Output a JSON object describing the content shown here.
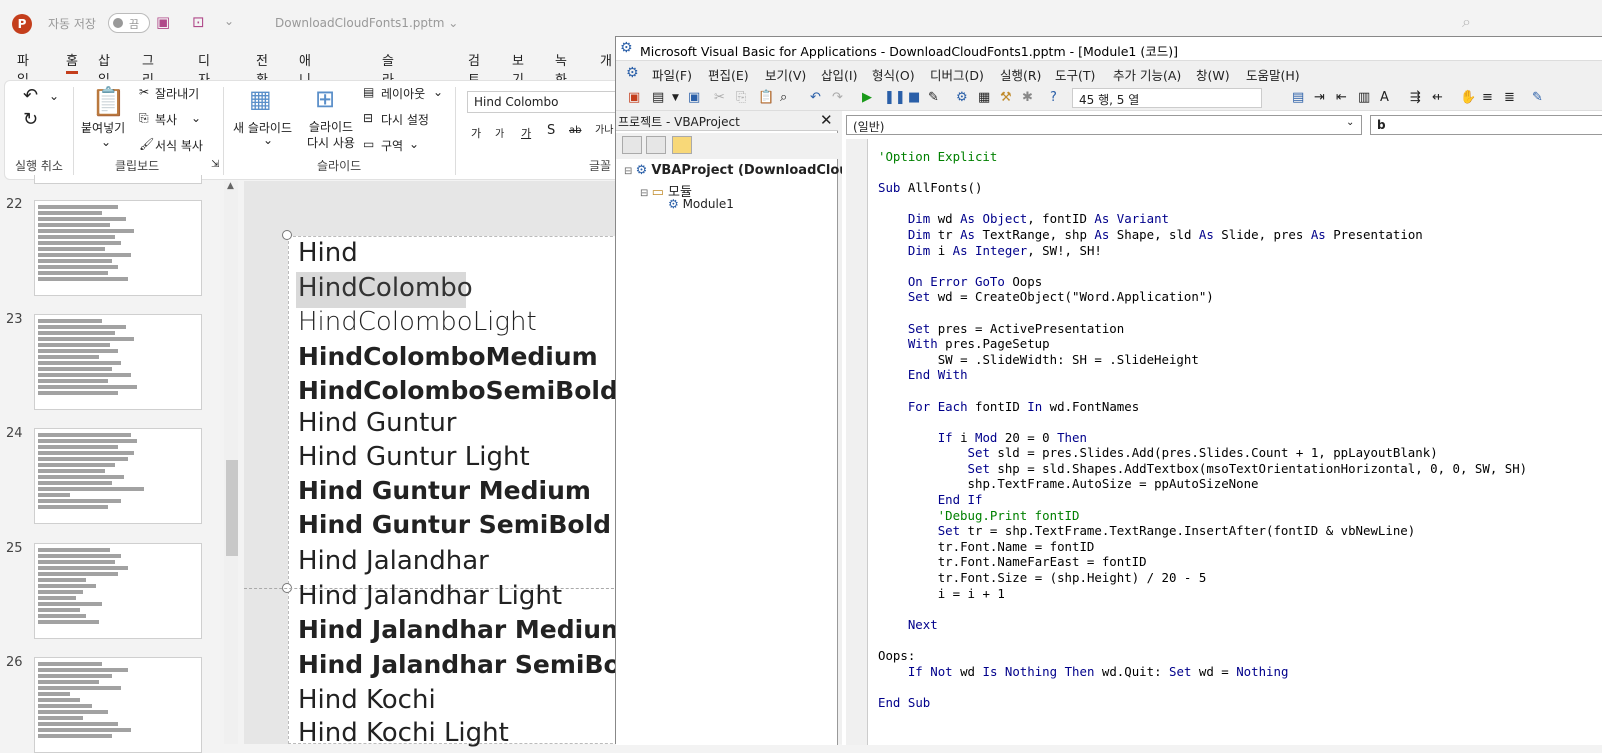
{
  "ppt": {
    "logo": "P",
    "autosave_label": "자동 저장",
    "toggle_text": "끔",
    "filename": "DownloadCloudFonts1.pptm ⌄",
    "tabs": [
      "파일",
      "홈",
      "삽입",
      "그리기",
      "디자인",
      "전환",
      "애니메이션",
      "슬라이드 쇼",
      "검토",
      "보기",
      "녹화",
      "개"
    ],
    "ribbon": {
      "undo_group": "실행 취소",
      "paste": "붙여넣기",
      "cut": "잘라내기",
      "copy": "복사",
      "format_painter": "서식 복사",
      "clipboard_group": "클립보드",
      "new_slide": "새 슬라이드",
      "reuse_slide": "슬라이드 다시 사용",
      "layout": "레이아웃",
      "reset": "다시 설정",
      "section": "구역",
      "slides_group": "슬라이드",
      "font_name": "Hind Colombo",
      "font_group": "글꼴",
      "font_buttons": [
        "가",
        "가",
        "가",
        "S",
        "ab",
        "가나"
      ]
    },
    "thumbnail_numbers": [
      "22",
      "23",
      "24",
      "25",
      "26"
    ],
    "slide_lines": [
      {
        "text": "Hind",
        "bold": false
      },
      {
        "text": "HindColombo",
        "bold": false
      },
      {
        "text": "HindColomboLight",
        "bold": false
      },
      {
        "text": "HindColomboMedium",
        "bold": true
      },
      {
        "text": "HindColomboSemiBold",
        "bold": true
      },
      {
        "text": "Hind Guntur",
        "bold": false
      },
      {
        "text": "Hind Guntur Light",
        "bold": false
      },
      {
        "text": "Hind Guntur Medium",
        "bold": true
      },
      {
        "text": "Hind Guntur SemiBold",
        "bold": true
      },
      {
        "text": "Hind Jalandhar",
        "bold": false
      },
      {
        "text": "Hind Jalandhar Light",
        "bold": false
      },
      {
        "text": "Hind Jalandhar Medium",
        "bold": true
      },
      {
        "text": "Hind Jalandhar SemiBold",
        "bold": true
      },
      {
        "text": "Hind Kochi",
        "bold": false
      },
      {
        "text": "Hind Kochi Light",
        "bold": false
      }
    ]
  },
  "vba": {
    "title": "Microsoft Visual Basic for Applications - DownloadCloudFonts1.pptm - [Module1 (코드)]",
    "menu": [
      "파일(F)",
      "편집(E)",
      "보기(V)",
      "삽입(I)",
      "형식(O)",
      "디버그(D)",
      "실행(R)",
      "도구(T)",
      "추가 기능(A)",
      "창(W)",
      "도움말(H)"
    ],
    "position": "45 행, 5 열",
    "project_title": "프로젝트 - VBAProject",
    "tree": {
      "root": "VBAProject (DownloadClou",
      "folder": "모듈",
      "module": "Module1"
    },
    "object_combo": "(일반)",
    "proc_combo": "b",
    "code_lines": [
      "'Option Explicit",
      "",
      "Sub AllFonts()",
      "",
      "    Dim wd As Object, fontID As Variant",
      "    Dim tr As TextRange, shp As Shape, sld As Slide, pres As Presentation",
      "    Dim i As Integer, SW!, SH!",
      "",
      "    On Error GoTo Oops",
      "    Set wd = CreateObject(\"Word.Application\")",
      "",
      "    Set pres = ActivePresentation",
      "    With pres.PageSetup",
      "        SW = .SlideWidth: SH = .SlideHeight",
      "    End With",
      "",
      "    For Each fontID In wd.FontNames",
      "",
      "        If i Mod 20 = 0 Then",
      "            Set sld = pres.Slides.Add(pres.Slides.Count + 1, ppLayoutBlank)",
      "            Set shp = sld.Shapes.AddTextbox(msoTextOrientationHorizontal, 0, 0, SW, SH)",
      "            shp.TextFrame.AutoSize = ppAutoSizeNone",
      "        End If",
      "        'Debug.Print fontID",
      "        Set tr = shp.TextFrame.TextRange.InsertAfter(fontID & vbNewLine)",
      "        tr.Font.Name = fontID",
      "        tr.Font.NameFarEast = fontID",
      "        tr.Font.Size = (shp.Height) / 20 - 5",
      "        i = i + 1",
      "",
      "    Next",
      "",
      "Oops:",
      "    If Not wd Is Nothing Then wd.Quit: Set wd = Nothing",
      "",
      "End Sub"
    ]
  }
}
